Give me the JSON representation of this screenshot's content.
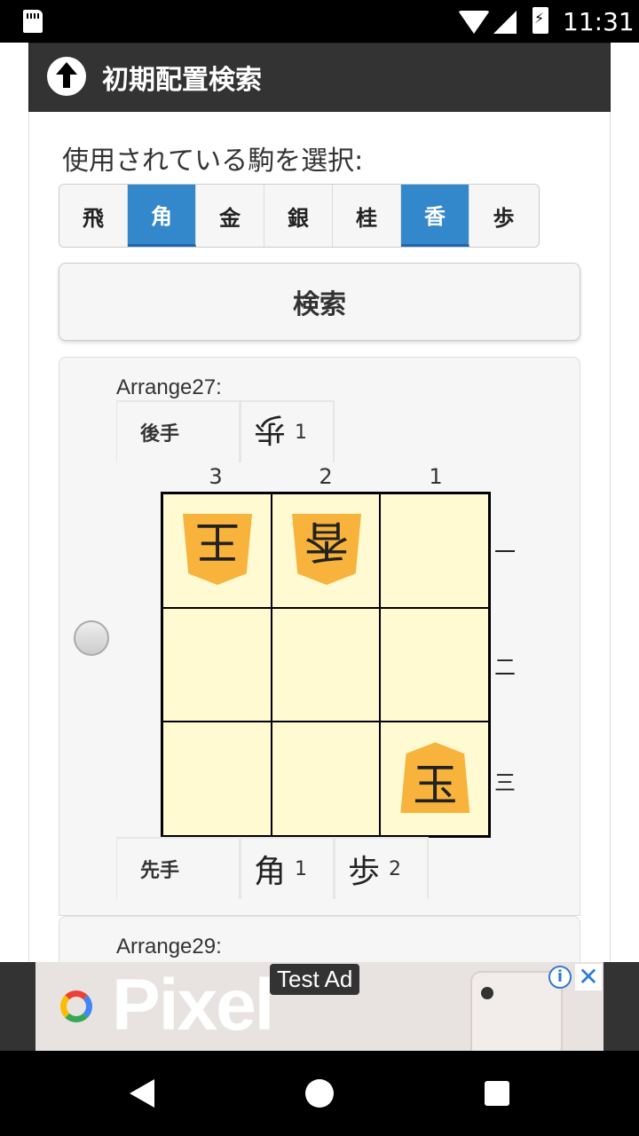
{
  "status_bar": {
    "time": "11:31"
  },
  "header": {
    "title": "初期配置検索"
  },
  "selector": {
    "label": "使用されている駒を選択:",
    "pieces": [
      {
        "label": "飛",
        "selected": false
      },
      {
        "label": "角",
        "selected": true
      },
      {
        "label": "金",
        "selected": false
      },
      {
        "label": "銀",
        "selected": false
      },
      {
        "label": "桂",
        "selected": false
      },
      {
        "label": "香",
        "selected": true
      },
      {
        "label": "歩",
        "selected": false
      }
    ],
    "accent_color": "#3388cc"
  },
  "search_button": {
    "label": "検索"
  },
  "results": [
    {
      "title": "Arrange27:",
      "gote": {
        "label": "後手",
        "hand": [
          {
            "piece": "歩",
            "count": "1"
          }
        ]
      },
      "columns": [
        "3",
        "2",
        "1"
      ],
      "rows": [
        "一",
        "二",
        "三"
      ],
      "board": {
        "r1c3": {
          "piece": "王",
          "owner": "gote"
        },
        "r1c2": {
          "piece": "香",
          "owner": "gote"
        },
        "r3c1": {
          "piece": "玉",
          "owner": "sente"
        }
      },
      "sente": {
        "label": "先手",
        "hand": [
          {
            "piece": "角",
            "count": "1"
          },
          {
            "piece": "歩",
            "count": "2"
          }
        ]
      }
    },
    {
      "title": "Arrange29:"
    }
  ],
  "ad": {
    "brand": "Pixel",
    "badge": "Test Ad",
    "info": "i",
    "close": "✕"
  }
}
